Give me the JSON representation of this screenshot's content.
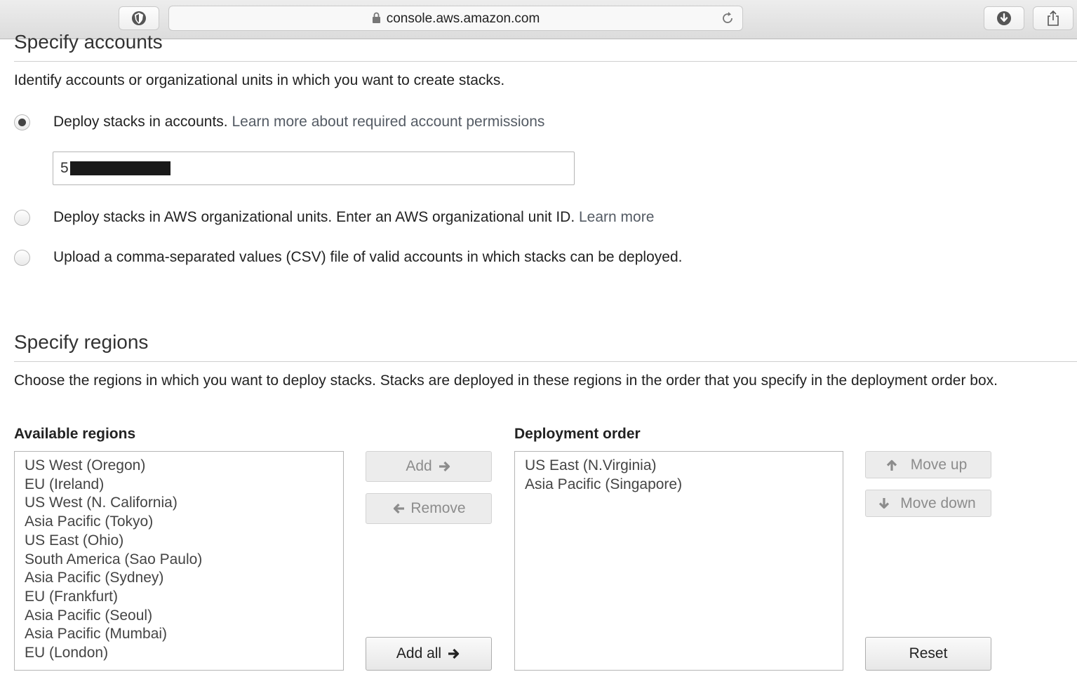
{
  "browser": {
    "url": "console.aws.amazon.com",
    "icons": [
      "shield-icon",
      "lock-icon",
      "reload-icon",
      "download-icon",
      "share-icon"
    ]
  },
  "accounts": {
    "title": "Specify accounts",
    "description": "Identify accounts or organizational units in which you want to create stacks.",
    "options": [
      {
        "label": "Deploy stacks in accounts.",
        "link": "Learn more about required account permissions",
        "selected": true
      },
      {
        "label": "Deploy stacks in AWS organizational units. Enter an AWS organizational unit ID.",
        "link": "Learn more",
        "selected": false
      },
      {
        "label": "Upload a comma-separated values (CSV) file of valid accounts in which stacks can be deployed.",
        "link": "",
        "selected": false
      }
    ],
    "account_input_value": "5"
  },
  "regions": {
    "title": "Specify regions",
    "description": "Choose the regions in which you want to deploy stacks. Stacks are deployed in these regions in the order that you specify in the deployment order box.",
    "available_label": "Available regions",
    "available": [
      "US West (Oregon)",
      "EU (Ireland)",
      "US West (N. California)",
      "Asia Pacific (Tokyo)",
      "US East (Ohio)",
      "South America (Sao Paulo)",
      "Asia Pacific (Sydney)",
      "EU (Frankfurt)",
      "Asia Pacific (Seoul)",
      "Asia Pacific (Mumbai)",
      "EU (London)"
    ],
    "order_label": "Deployment order",
    "order": [
      "US East (N.Virginia)",
      "Asia Pacific (Singapore)"
    ],
    "buttons": {
      "add": "Add",
      "remove": "Remove",
      "add_all": "Add all",
      "move_up": "Move up",
      "move_down": "Move down",
      "reset": "Reset"
    }
  },
  "colors": {
    "link": "#545b64",
    "disabled_text": "#8c8c8c",
    "border": "#b5b5b5"
  }
}
